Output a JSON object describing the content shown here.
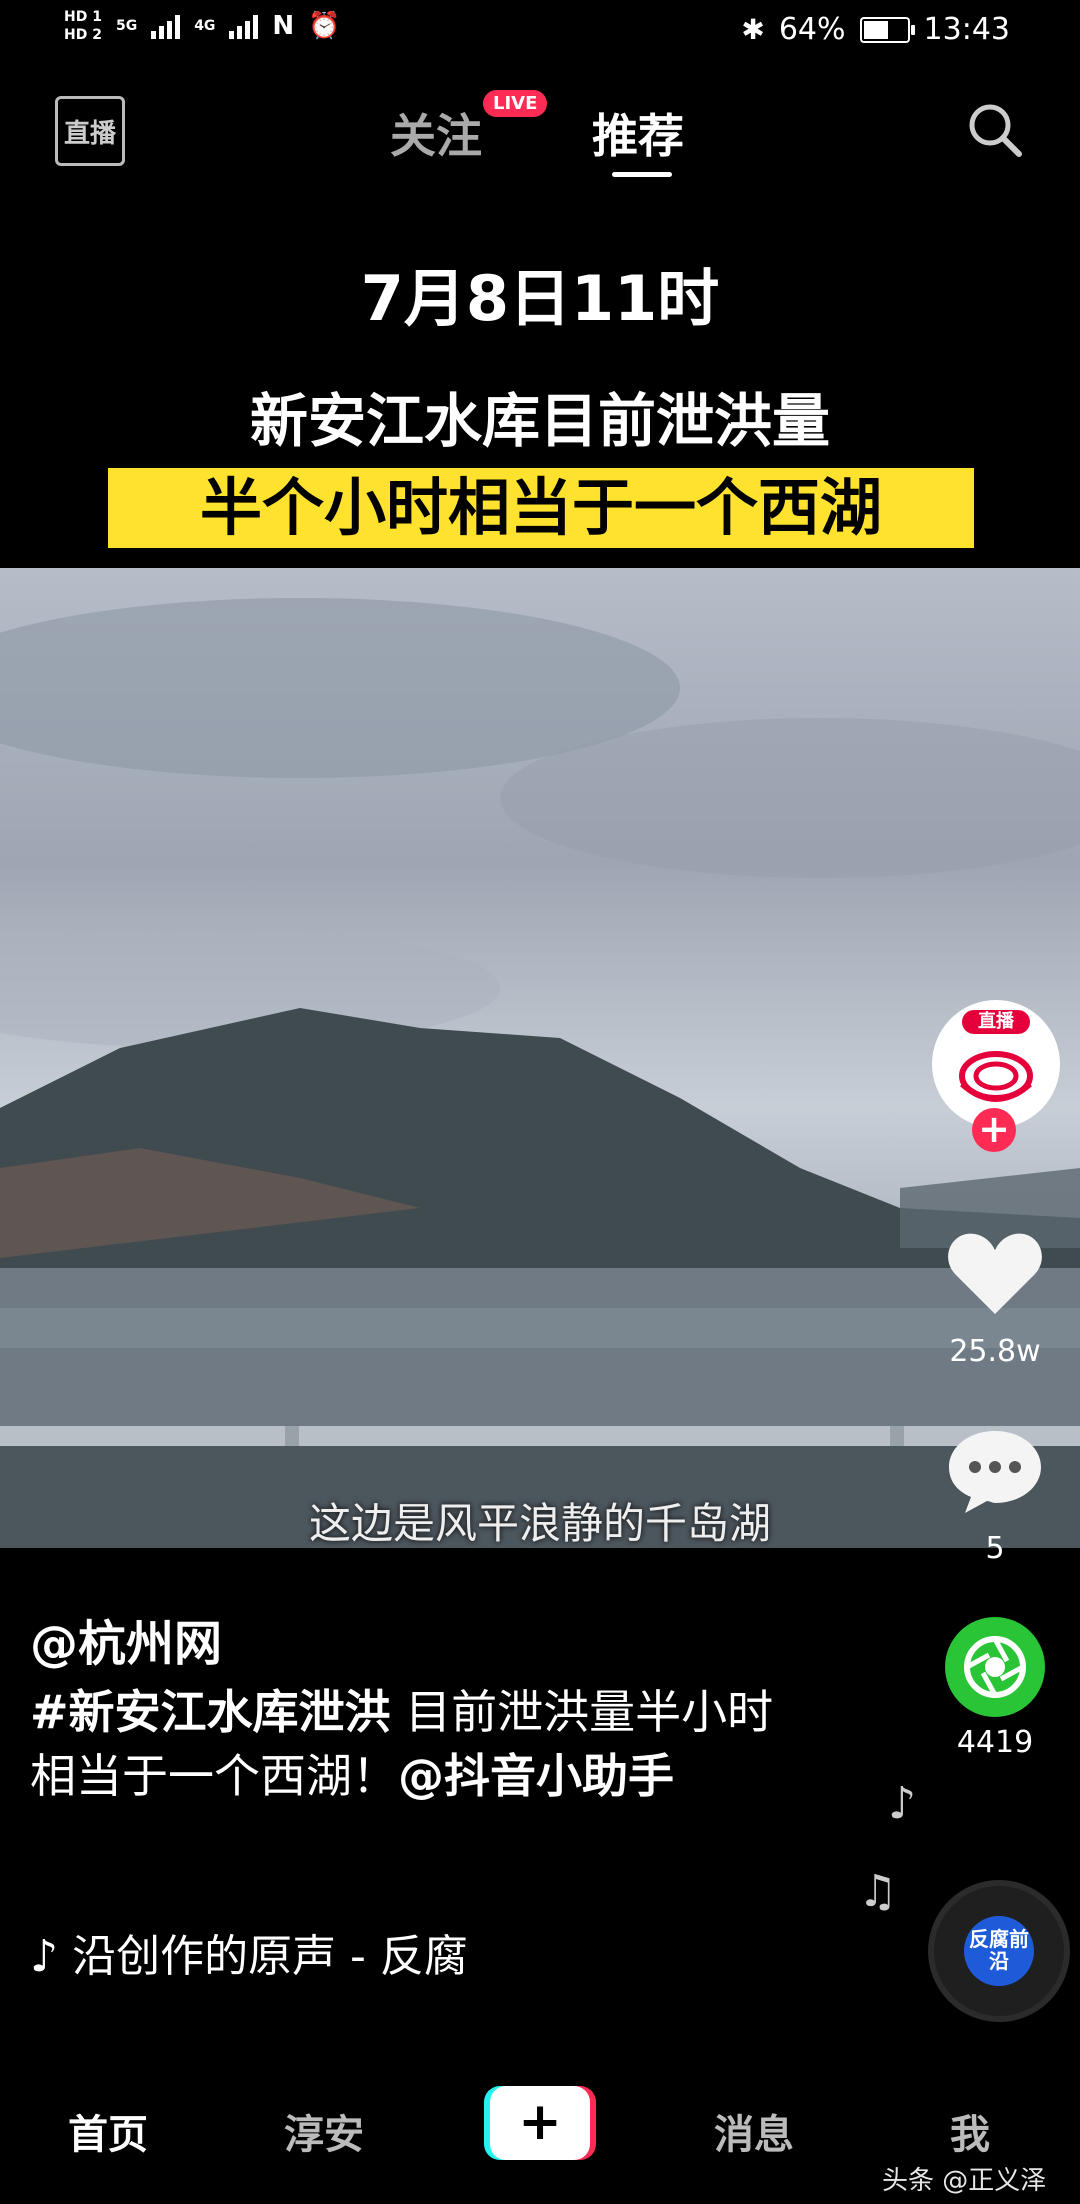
{
  "status_bar": {
    "hd1": "HD 1",
    "hd2": "HD 2",
    "net1": "5G",
    "net2": "4G",
    "battery": "64%",
    "battery_fraction": 0.64,
    "time": "13:43"
  },
  "top_nav": {
    "live": "直播",
    "follow": "关注",
    "live_badge": "LIVE",
    "recommend": "推荐"
  },
  "video": {
    "title_line1": "7月8日11时",
    "title_line2": "新安江水库目前泄洪量",
    "title_line3": "半个小时相当于一个西湖",
    "subtitle": "这边是风平浪静的千岛湖"
  },
  "actions": {
    "avatar_label": "直播",
    "follow_plus": "+",
    "likes": "25.8w",
    "comments": "5",
    "shares": "4419"
  },
  "info": {
    "author": "@杭州网",
    "hashtag": "#新安江水库泄洪",
    "caption_text": " 目前泄洪量半小时相当于一个西湖！",
    "mention": "@抖音小助手",
    "music": "♪ 沿创作的原声 - 反腐",
    "disc_text": "反腐前沿"
  },
  "bottom_tabs": {
    "home": "首页",
    "local": "淳安",
    "plus": "+",
    "messages": "消息",
    "me": "我"
  },
  "watermark": "头条 @正义泽"
}
